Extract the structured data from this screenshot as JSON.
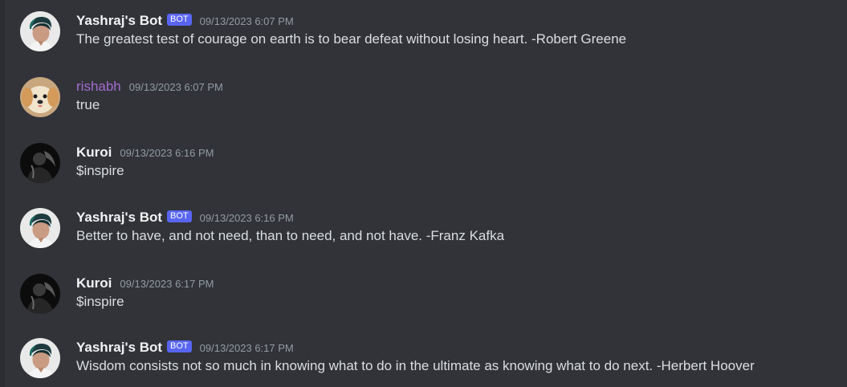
{
  "messages": [
    {
      "author": "Yashraj's Bot",
      "bot_tag": "BOT",
      "timestamp": "09/13/2023 6:07 PM",
      "content": "The greatest test of courage on earth is to bear defeat without losing heart. -Robert Greene",
      "avatar": "yashraj-avatar"
    },
    {
      "author": "rishabh",
      "timestamp": "09/13/2023 6:07 PM",
      "content": "true",
      "avatar": "puppy-avatar"
    },
    {
      "author": "Kuroi",
      "timestamp": "09/13/2023 6:16 PM",
      "content": "$inspire",
      "avatar": "dark-avatar"
    },
    {
      "author": "Yashraj's Bot",
      "bot_tag": "BOT",
      "timestamp": "09/13/2023 6:16 PM",
      "content": "Better to have, and not need, than to need, and not have. -Franz Kafka",
      "avatar": "yashraj-avatar"
    },
    {
      "author": "Kuroi",
      "timestamp": "09/13/2023 6:17 PM",
      "content": "$inspire",
      "avatar": "dark-avatar"
    },
    {
      "author": "Yashraj's Bot",
      "bot_tag": "BOT",
      "timestamp": "09/13/2023 6:17 PM",
      "content": "Wisdom consists not so much in knowing what to do in the ultimate as knowing what to do next. -Herbert Hoover",
      "avatar": "yashraj-avatar"
    }
  ],
  "colors": {
    "background": "#313338",
    "bot_tag": "#5865f2",
    "username": "#f2f3f5",
    "rishabh_username": "#a46bd1",
    "timestamp": "#949ba4",
    "text": "#dbdee1"
  }
}
